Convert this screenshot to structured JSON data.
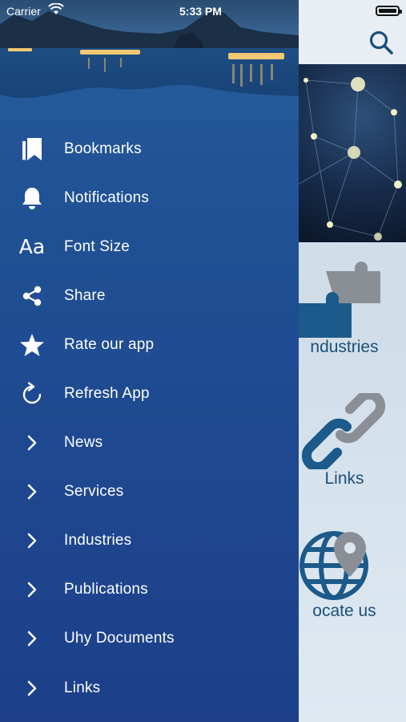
{
  "status_bar": {
    "carrier": "Carrier",
    "time": "5:33 PM"
  },
  "drawer": {
    "menu": [
      {
        "label": "Bookmarks",
        "icon": "bookmark-icon"
      },
      {
        "label": "Notifications",
        "icon": "bell-icon"
      },
      {
        "label": "Font Size",
        "icon": "font-size-icon",
        "glyph": "Aa"
      },
      {
        "label": "Share",
        "icon": "share-icon"
      },
      {
        "label": "Rate our app",
        "icon": "star-icon"
      },
      {
        "label": "Refresh App",
        "icon": "refresh-icon"
      },
      {
        "label": "News",
        "icon": "chevron-right-icon"
      },
      {
        "label": "Services",
        "icon": "chevron-right-icon"
      },
      {
        "label": "Industries",
        "icon": "chevron-right-icon"
      },
      {
        "label": "Publications",
        "icon": "chevron-right-icon"
      },
      {
        "label": "Uhy Documents",
        "icon": "chevron-right-icon"
      },
      {
        "label": "Links",
        "icon": "chevron-right-icon"
      }
    ]
  },
  "page": {
    "tiles": [
      {
        "label": "ndustries",
        "icon": "puzzle-icon"
      },
      {
        "label": "Links",
        "icon": "link-icon"
      },
      {
        "label": "ocate us",
        "icon": "globe-location-icon"
      }
    ]
  },
  "colors": {
    "drawer_top": "#245a9a",
    "drawer_bottom": "#1d3f8a",
    "accent": "#1b4f7a"
  }
}
